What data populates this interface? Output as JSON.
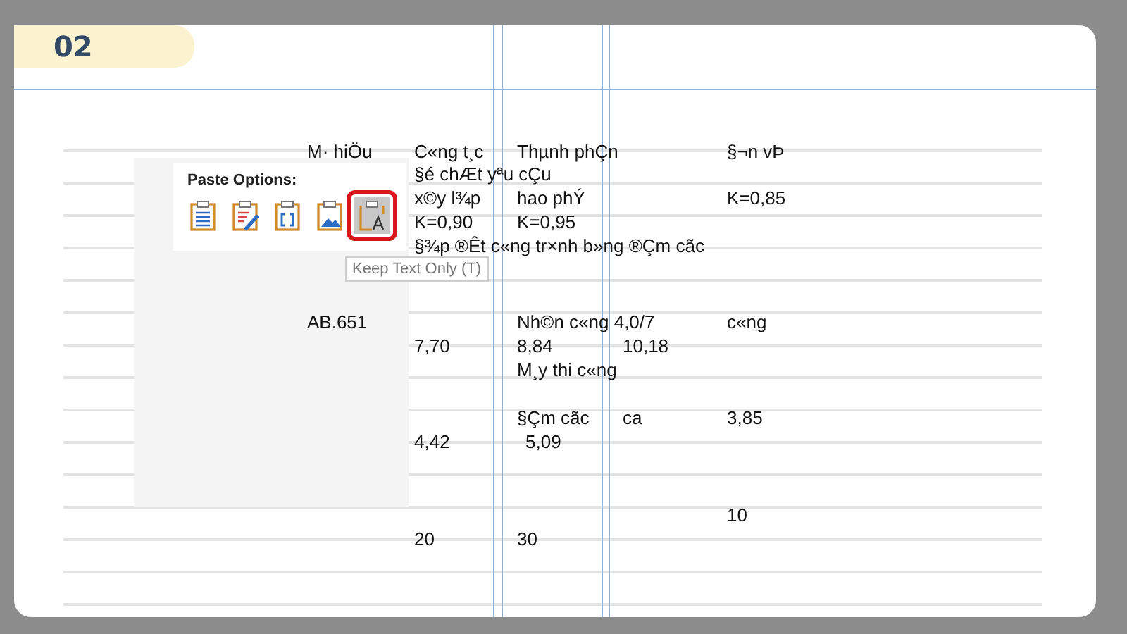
{
  "badge": "02",
  "document_text": [
    "M· hiÖu",
    "C«ng t¸c",
    "Thµnh phÇn",
    "§¬n vÞ",
    "§é chÆt yªu cÇu",
    "x©y l¾p",
    "hao phÝ",
    "K=0,85",
    "K=0,90",
    "K=0,95",
    "§¾p ®Êt c«ng tr×nh b»ng ®Çm cãc",
    "AB.651",
    "Nh©n c«ng 4,0/7",
    "c«ng",
    "7,70",
    "8,84",
    "10,18",
    "M¸y thi c«ng",
    "§Çm cãc",
    "ca",
    "3,85",
    "4,42",
    "5,09",
    "10",
    "20",
    "30"
  ],
  "paste_options": {
    "title": "Paste Options:",
    "options": [
      {
        "kind": "keep-source",
        "selected": false
      },
      {
        "kind": "merge",
        "selected": false
      },
      {
        "kind": "brackets",
        "selected": false
      },
      {
        "kind": "picture",
        "selected": false
      },
      {
        "kind": "text-only",
        "selected": true
      }
    ],
    "tooltip": "Keep Text Only (T)"
  }
}
